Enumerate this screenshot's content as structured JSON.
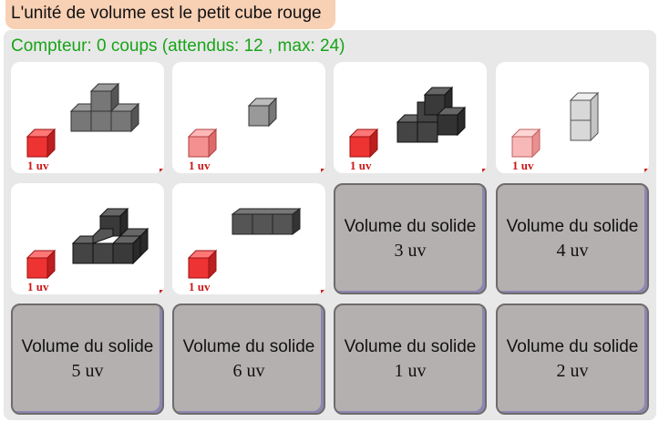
{
  "instruction": "L'unité de volume est le petit cube rouge",
  "counter": "Compteur: 0 coups (attendus: 12 , max: 24)",
  "unit_label": "1 uv",
  "text_cards": [
    {
      "title": "Volume du solide",
      "value": "3 uv"
    },
    {
      "title": "Volume du solide",
      "value": "4 uv"
    },
    {
      "title": "Volume du solide",
      "value": "5 uv"
    },
    {
      "title": "Volume du solide",
      "value": "6 uv"
    },
    {
      "title": "Volume du solide",
      "value": "1 uv"
    },
    {
      "title": "Volume du solide",
      "value": "2 uv"
    }
  ],
  "colors": {
    "unit_cube": "#ee3333",
    "counter_text": "#18a418",
    "instruction_bg": "#f8d0b4",
    "card_bg": "#b5b0b0"
  }
}
